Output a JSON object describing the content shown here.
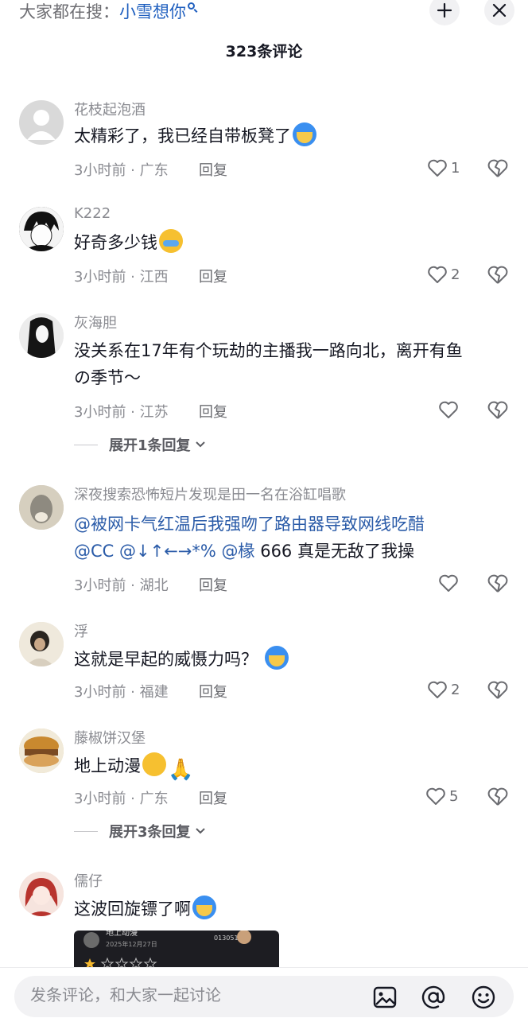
{
  "header": {
    "search_prefix": "大家都在搜：",
    "search_keyword": "小雪想你",
    "comment_count_label": "323条评论"
  },
  "comments": [
    {
      "username": "花枝起泡酒",
      "text": "太精彩了，我已经自带板凳了",
      "emoji": "blue-face-emoji",
      "meta": "3小时前 · 广东",
      "reply_label": "回复",
      "likes": "1"
    },
    {
      "username": "K222",
      "text": "好奇多少钱",
      "emoji": "crying-face-emoji",
      "meta": "3小时前 · 江西",
      "reply_label": "回复",
      "likes": "2"
    },
    {
      "username": "灰海胆",
      "text_line1": "没关系在17年有个玩劫的主播我一路向北，离开有鱼",
      "text_line2": "の季节～",
      "meta": "3小时前 · 江苏",
      "reply_label": "回复",
      "likes": "",
      "expand_label": "展开1条回复"
    },
    {
      "username": "深夜搜索恐怖短片发现是田一名在浴缸唱歌",
      "mention1": "@被网卡气红温后我强吻了路由器导致网线吃醋",
      "mention2": "@CC @↓↑←→*%",
      "mention3": "@椽",
      "text_tail": " 666 真是无敌了我操",
      "meta": "3小时前 · 湖北",
      "reply_label": "回复",
      "likes": ""
    },
    {
      "username": "浮",
      "text": "这就是早起的威慑力吗？",
      "emoji": "blue-face-emoji",
      "meta": "3小时前 · 福建",
      "reply_label": "回复",
      "likes": "2"
    },
    {
      "username": "藤椒饼汉堡",
      "text": "地上动漫",
      "emoji": "pleading-face-emoji",
      "emoji2": "🙏",
      "meta": "3小时前 · 广东",
      "reply_label": "回复",
      "likes": "5",
      "expand_label": "展开3条回复"
    },
    {
      "username": "儒仔",
      "text": "这波回旋镖了啊",
      "emoji": "blue-face-emoji",
      "thumb_title": "地上动漫",
      "thumb_date": "2025年12月27日",
      "thumb_code": "013051"
    }
  ],
  "bottom_bar": {
    "placeholder": "发条评论，和大家一起讨论",
    "icons": [
      "image-icon",
      "at-icon",
      "emoji-icon"
    ]
  },
  "colors": {
    "mention": "#2a5ba8",
    "keyword": "#1f5fbf",
    "muted": "#8a8b91"
  }
}
